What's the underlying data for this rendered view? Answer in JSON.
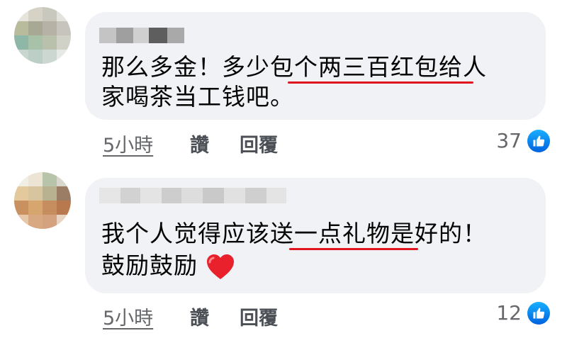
{
  "comments": [
    {
      "text_line1": "那么多金！多少包个两三百红包给人",
      "text_line2": "家喝茶当工钱吧。",
      "time": "5小時",
      "like_label": "讚",
      "reply_label": "回覆",
      "like_count": "37"
    },
    {
      "text_line1": "我个人觉得应该送一点礼物是好的！",
      "text_line2": "鼓励鼓励",
      "time": "5小時",
      "like_label": "讚",
      "reply_label": "回覆",
      "like_count": "12"
    }
  ],
  "colors": {
    "bubble": "#f0f2f5",
    "underline": "#e0141e",
    "like_blue": "#1877f2",
    "meta_gray": "#65676b"
  },
  "icons": {
    "reaction": "thumbs-up-icon",
    "emoji": "red-heart-icon"
  }
}
